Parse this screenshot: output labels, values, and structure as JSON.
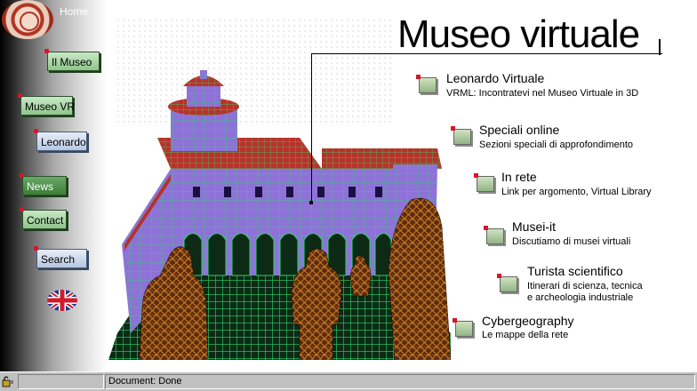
{
  "sidebar": {
    "home_label": "Home",
    "nav": [
      {
        "label": "Il Museo"
      },
      {
        "label": "Museo VR"
      },
      {
        "label": "Leonardo"
      },
      {
        "label": "News"
      },
      {
        "label": "Contact"
      },
      {
        "label": "Search"
      }
    ]
  },
  "main": {
    "title": "Museo virtuale",
    "items": [
      {
        "title": "Leonardo Virtuale",
        "subtitle": "VRML: Incontratevi nel Museo Virtuale in 3D"
      },
      {
        "title": "Speciali online",
        "subtitle": "Sezioni speciali di approfondimento"
      },
      {
        "title": "In rete",
        "subtitle": "Link per argomento, Virtual Library"
      },
      {
        "title": "Musei-it",
        "subtitle": "Discutiamo di musei virtuali"
      },
      {
        "title": "Turista scientifico",
        "subtitle": "Itinerari di scienza, tecnica",
        "subtitle2": "e archeologia industriale"
      },
      {
        "title": "Cybergeography",
        "subtitle": "Le mappe della rete"
      }
    ]
  },
  "statusbar": {
    "text": "Document: Done"
  },
  "colors": {
    "accent_red": "#d4182a",
    "button_green": "#8fc48b",
    "wireframe_green": "#2ed46c",
    "wall_purple": "#8e72d8"
  }
}
